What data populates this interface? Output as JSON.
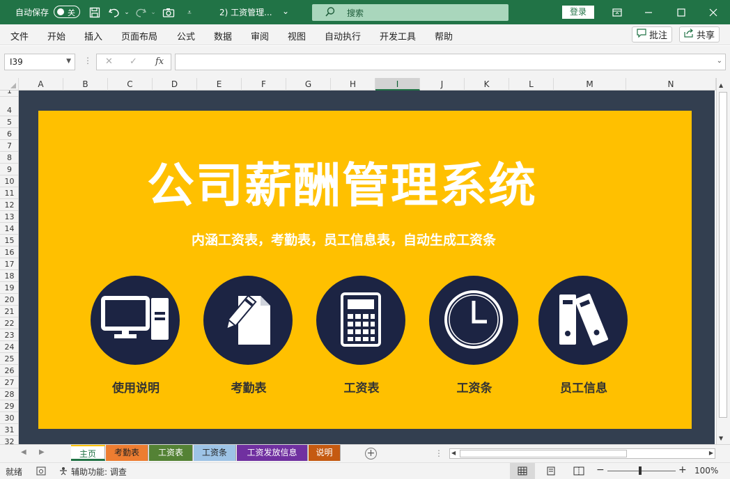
{
  "titlebar": {
    "autosave_label": "自动保存",
    "autosave_state": "关",
    "doc_title": "2) 工资管理...",
    "search_label": "搜索",
    "login_label": "登录"
  },
  "ribbon": {
    "tabs": [
      "文件",
      "开始",
      "插入",
      "页面布局",
      "公式",
      "数据",
      "审阅",
      "视图",
      "自动执行",
      "开发工具",
      "帮助"
    ],
    "comment_label": "批注",
    "share_label": "共享"
  },
  "formula_bar": {
    "name_box": "I39",
    "fx_label": "fx",
    "formula": ""
  },
  "grid": {
    "columns": [
      "A",
      "B",
      "C",
      "D",
      "E",
      "F",
      "G",
      "H",
      "I",
      "J",
      "K",
      "L",
      "M",
      "N"
    ],
    "selected_column": "I",
    "rows": [
      "1",
      "4",
      "5",
      "6",
      "7",
      "8",
      "9",
      "10",
      "11",
      "12",
      "13",
      "14",
      "15",
      "16",
      "17",
      "18",
      "19",
      "20",
      "21",
      "22",
      "23",
      "24",
      "25",
      "26",
      "27",
      "28",
      "29",
      "30",
      "31",
      "32"
    ]
  },
  "dashboard": {
    "title": "公司薪酬管理系统",
    "subtitle": "内涵工资表，考勤表，员工信息表，自动生成工资条",
    "tiles": [
      {
        "label": "使用说明",
        "icon": "computer-icon"
      },
      {
        "label": "考勤表",
        "icon": "document-pencil-icon"
      },
      {
        "label": "工资表",
        "icon": "calculator-icon"
      },
      {
        "label": "工资条",
        "icon": "clock-icon"
      },
      {
        "label": "员工信息",
        "icon": "binders-icon"
      }
    ],
    "colors": {
      "background": "#333f50",
      "panel": "#ffc000",
      "circle": "#1c2443",
      "text": "#ffffff"
    }
  },
  "sheets": {
    "tabs": [
      {
        "label": "主页",
        "color": "#ffffff"
      },
      {
        "label": "考勤表",
        "color": "#ed7d31"
      },
      {
        "label": "工资表",
        "color": "#548235"
      },
      {
        "label": "工资条",
        "color": "#9dc3e6"
      },
      {
        "label": "工资发放信息",
        "color": "#7030a0"
      },
      {
        "label": "说明",
        "color": "#c55a11"
      }
    ]
  },
  "statusbar": {
    "ready": "就绪",
    "accessibility": "辅助功能: 调查",
    "zoom": "100%",
    "zoom_minus": "−",
    "zoom_plus": "+"
  }
}
